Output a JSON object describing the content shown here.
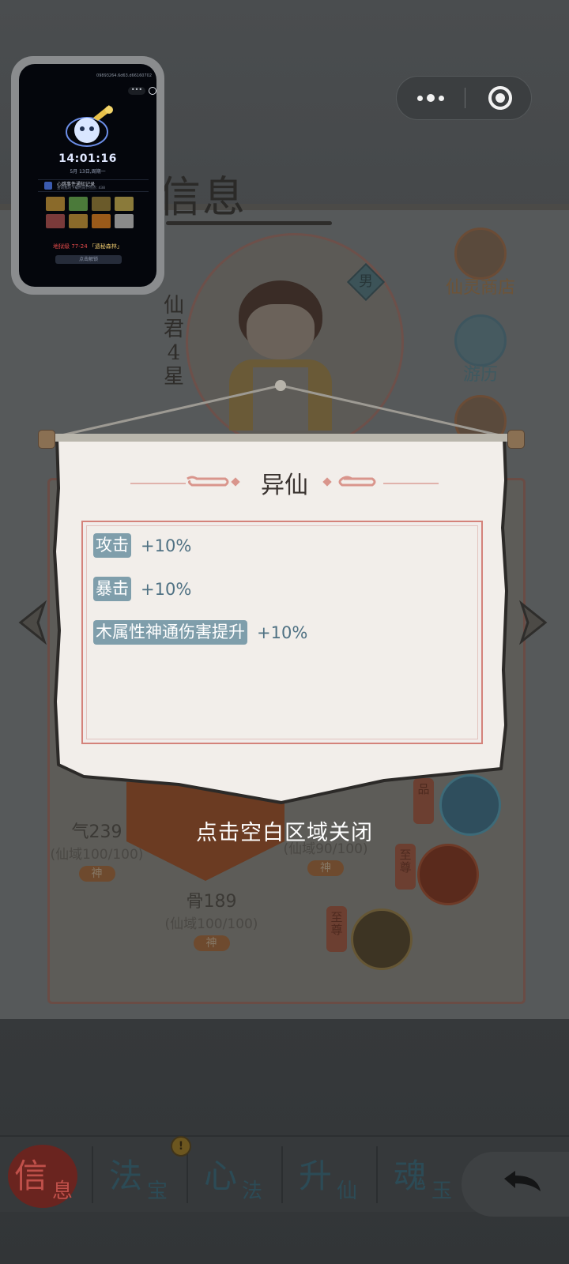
{
  "page": {
    "title": "信息"
  },
  "character": {
    "rank_vertical": [
      "仙",
      "君",
      "4",
      "星"
    ],
    "gender": "男"
  },
  "side_buttons": [
    {
      "label": "仙灵商店",
      "icon": "shop-icon"
    },
    {
      "label": "游历",
      "icon": "travel-icon"
    }
  ],
  "stats": {
    "qi": {
      "value": "气239",
      "sub": "(仙域100/100)",
      "tag": "神"
    },
    "other": {
      "sub": "(仙域90/100)",
      "tag": "神"
    },
    "bone": {
      "value": "骨189",
      "sub": "(仙域100/100)",
      "tag": "神"
    }
  },
  "vertical_tags": [
    "品",
    "至尊",
    "至尊"
  ],
  "popup": {
    "title": "异仙",
    "attributes": [
      {
        "name": "攻击",
        "value": "+10%"
      },
      {
        "name": "暴击",
        "value": "+10%"
      },
      {
        "name": "木属性神通伤害提升",
        "value": "+10%"
      }
    ],
    "close_hint": "点击空白区域关闭"
  },
  "pip": {
    "id_text": "09893264.6d63.d66160702",
    "time": "14:01:16",
    "date": "5月 13日,周期一",
    "row_title": "心跳事件通知记录",
    "row_sub": "查询我的下载时间节点点: 438",
    "level_prefix": "地狱级 77-24",
    "level_name": "「遗秘森林」",
    "button": "点击解锁",
    "grid_colors": [
      "#8a6a2a",
      "#4b7a3a",
      "#6a5a2a",
      "#8a7a3a",
      "#7a3a3a",
      "#8a6a2a",
      "#9a5a1a",
      "#8a8a8a"
    ]
  },
  "tabs": [
    {
      "big": "信",
      "small": "息",
      "active": true
    },
    {
      "big": "法",
      "small": "宝"
    },
    {
      "big": "心",
      "small": "法"
    },
    {
      "big": "升",
      "small": "仙"
    },
    {
      "big": "魂",
      "small": "玉"
    }
  ],
  "badge": "!",
  "colors": {
    "accent_red": "#d4827a",
    "chip_blue": "#7f9eab",
    "value_blue": "#4f7183",
    "active_tab": "#c0504a"
  }
}
